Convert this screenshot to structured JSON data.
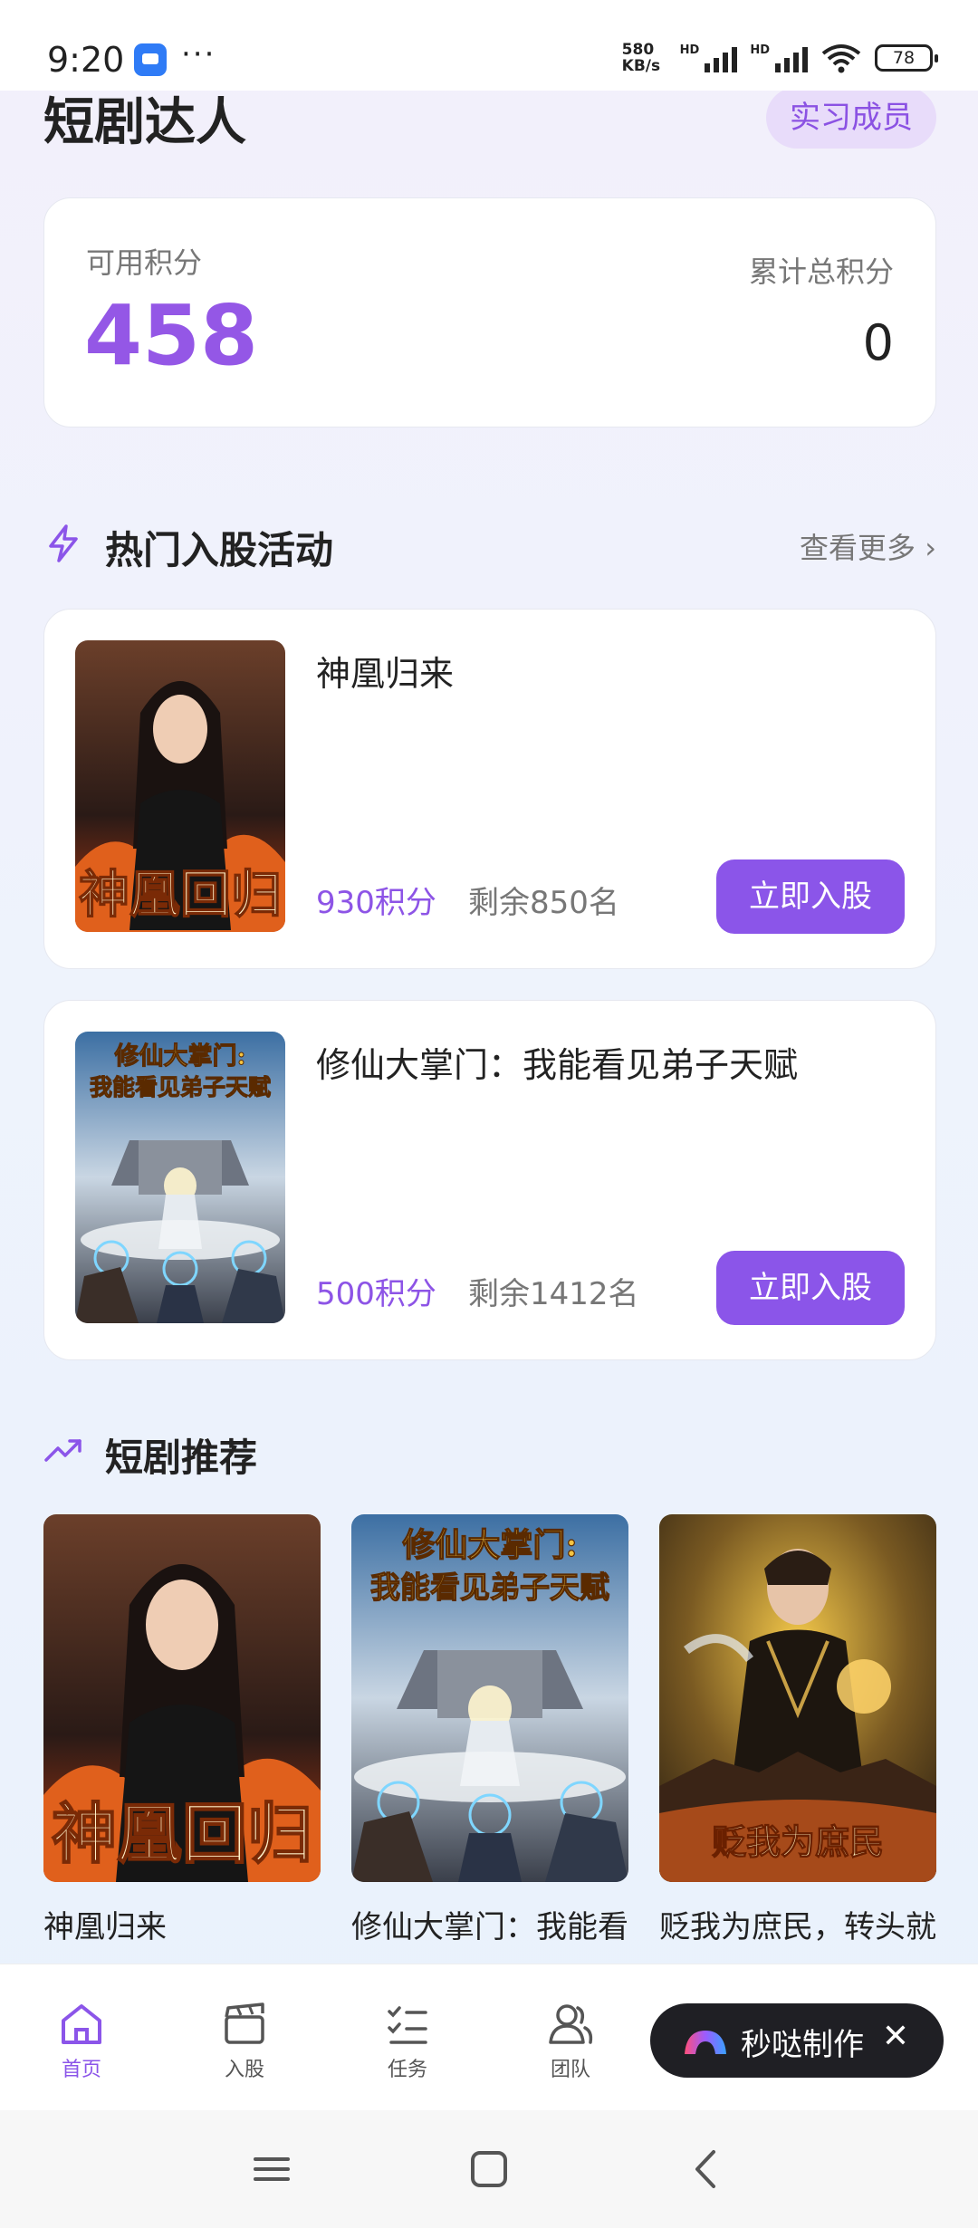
{
  "status_bar": {
    "time": "9:20",
    "dots": "···",
    "speed_top": "580",
    "speed_bottom": "KB/s",
    "hd1": "HD",
    "hd2": "HD",
    "battery": "78"
  },
  "header": {
    "title": "短剧达人",
    "role_badge": "实习成员"
  },
  "points": {
    "available_label": "可用积分",
    "available_value": "458",
    "total_label": "累计总积分",
    "total_value": "0"
  },
  "hot_section": {
    "title": "热门入股活动",
    "more": "查看更多",
    "items": [
      {
        "title": "神凰归来",
        "points": "930积分",
        "remaining": "剩余850名",
        "button": "立即入股",
        "poster_text": "神凰回归"
      },
      {
        "title": "修仙大掌门：我能看见弟子天赋",
        "points": "500积分",
        "remaining": "剩余1412名",
        "button": "立即入股",
        "poster_text": "修仙大掌门：我能看见弟子天赋"
      }
    ]
  },
  "rec_section": {
    "title": "短剧推荐",
    "items": [
      {
        "title": "神凰归来",
        "poster_text": "神凰回归"
      },
      {
        "title": "修仙大掌门：我能看",
        "poster_text": "修仙大掌门：我能看见弟子天赋"
      },
      {
        "title": "贬我为庶民，转头就",
        "poster_text": "贬我为庶民"
      }
    ]
  },
  "tabbar": {
    "items": [
      {
        "label": "首页",
        "icon": "home-icon"
      },
      {
        "label": "入股",
        "icon": "clapperboard-icon"
      },
      {
        "label": "任务",
        "icon": "checklist-icon"
      },
      {
        "label": "团队",
        "icon": "team-icon"
      }
    ],
    "active_color": "#8b55e9"
  },
  "floating": {
    "label": "秒哒制作",
    "close": "✕"
  },
  "colors": {
    "accent": "#8b55e9",
    "points_value": "#9457e6"
  }
}
